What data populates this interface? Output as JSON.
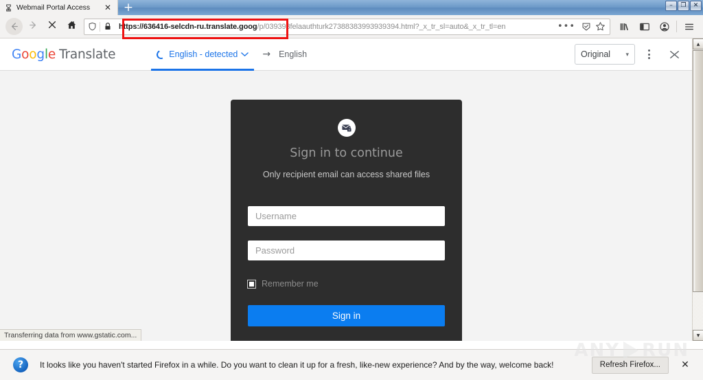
{
  "window": {
    "minimize_label": "–",
    "restore_label": "❐",
    "close_label": "✕"
  },
  "tabs": {
    "items": [
      {
        "title": "Webmail Portal Access",
        "favicon": "hourglass-loading-icon",
        "close_label": "✕"
      }
    ],
    "new_tab_label": "+"
  },
  "navbar": {
    "back_label": "←",
    "forward_label": "→",
    "stop_label": "✕",
    "home_label": "home-icon",
    "page_actions_label": "•••",
    "library_icon": "library-icon",
    "sidebar_icon": "sidebar-icon",
    "account_icon": "account-icon",
    "menu_icon": "hamburger-menu-icon"
  },
  "urlbar": {
    "shield_icon": "tracking-protection-shield-icon",
    "lock_icon": "padlock-secure-icon",
    "url_highlighted": "https://636416-selcdn-ru.translate.goog",
    "url_rest": "/p/039393felaauthturk27388383993939394.html?_x_tr_sl=auto&_x_tr_tl=en",
    "url_full": "https://636416-selcdn-ru.translate.goog/p/039393felaauthturk27388383993939394.html?_x_tr_sl=auto&_x_tr_tl=en",
    "bookmark_icon": "star-bookmark-icon",
    "reader_icon": "reader-view-icon",
    "highlight_color": "#ee1111"
  },
  "translate_bar": {
    "brand_google": [
      "G",
      "o",
      "o",
      "g",
      "l",
      "e"
    ],
    "brand_translate": "Translate",
    "source_language": "English - detected",
    "source_chevron": "⌄",
    "direction_arrow": "→",
    "target_language": "English",
    "view_mode": "Original",
    "view_chevron": "▾",
    "options_icon": "kebab-menu-icon",
    "collapse_icon": "collapse-chevrons-icon",
    "accent_color": "#1a73e8"
  },
  "login_card": {
    "badge_icon": "email-lock-icon",
    "title": "Sign in to continue",
    "subtitle": "Only recipient email can access shared files",
    "username_placeholder": "Username",
    "username_value": "",
    "password_placeholder": "Password",
    "password_value": "",
    "remember_label": "Remember me",
    "remember_checked": false,
    "signin_label": "Sign in",
    "card_bg": "#2d2d2d",
    "button_color": "#0b7df0"
  },
  "status": {
    "text": "Transferring data from www.gstatic.com..."
  },
  "notification": {
    "icon": "question-mark-icon",
    "message": "It looks like you haven't started Firefox in a while. Do you want to clean it up for a fresh, like-new experience? And by the way, welcome back!",
    "action_label": "Refresh Firefox...",
    "close_label": "✕"
  },
  "watermark": {
    "left_text": "ANY",
    "right_text": "RUN"
  },
  "scrollbar": {
    "up_label": "▲",
    "down_label": "▼"
  }
}
